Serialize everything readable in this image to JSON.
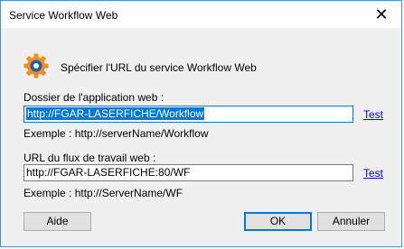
{
  "window": {
    "title": "Service Workflow Web",
    "close_glyph": "✕"
  },
  "header": {
    "icon": "gear-icon",
    "text": "Spécifier l'URL du service Workflow Web"
  },
  "webapp": {
    "label": "Dossier de l'application web :",
    "value": "http://FGAR-LASERFICHE/Workflow",
    "test_link": "Test",
    "example": "Exemple : http://serverName/Workflow"
  },
  "flow": {
    "label": "URL du flux de travail web :",
    "value": "http://FGAR-LASERFICHE:80/WF",
    "test_link": "Test",
    "example": "Exemple : http://ServerName/WF"
  },
  "buttons": {
    "help": "Aide",
    "ok": "OK",
    "cancel": "Annuler"
  },
  "colors": {
    "accent": "#0078d7",
    "icon_orange": "#f28c1e",
    "icon_blue": "#1f5fa8"
  }
}
